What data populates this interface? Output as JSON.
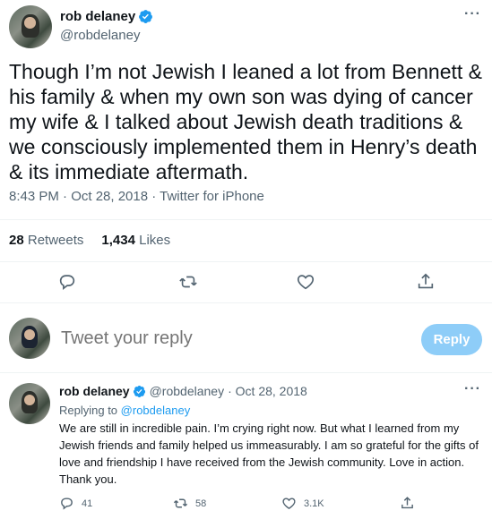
{
  "main_tweet": {
    "author_name": "rob delaney",
    "author_handle": "@robdelaney",
    "text": "Though I’m not Jewish I leaned a lot from Bennett & his family & when my own son was dying of cancer my wife & I talked about Jewish death traditions & we consciously implemented them in Henry’s death & its immediate aftermath.",
    "timestamp": "8:43 PM · Oct 28, 2018 · Twitter for iPhone",
    "retweets_count": "28",
    "retweets_label": "Retweets",
    "likes_count": "1,434",
    "likes_label": "Likes",
    "more_label": "···"
  },
  "composer": {
    "placeholder": "Tweet your reply",
    "button_label": "Reply"
  },
  "reply_tweet": {
    "author_name": "rob delaney",
    "author_handle": "@robdelaney",
    "date": "· Oct 28, 2018",
    "replying_prefix": "Replying to",
    "replying_to": "@robdelaney",
    "text": "We are still in incredible pain. I’m crying right now. But what I learned from my Jewish friends and family helped us immeasurably. I am so grateful for the gifts of love and friendship I have received from the Jewish community. Love in action. Thank you.",
    "reply_count": "41",
    "retweet_count": "58",
    "like_count": "3.1K",
    "more_label": "···"
  },
  "icons": [
    "verified-badge-icon",
    "reply-icon",
    "retweet-icon",
    "like-icon",
    "share-icon",
    "more-icon"
  ],
  "colors": {
    "accent": "#1d9bf0",
    "secondary_text": "#536471",
    "reply_button_disabled": "#8ecdf8"
  }
}
